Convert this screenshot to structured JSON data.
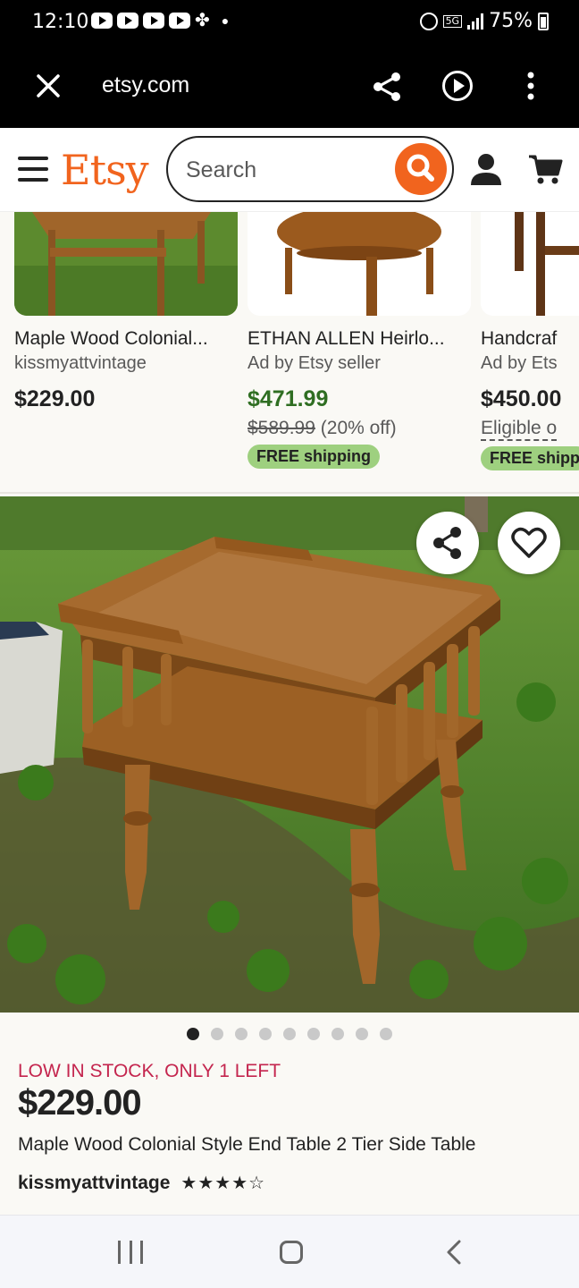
{
  "status_bar": {
    "time": "12:10",
    "network": "5G",
    "battery": "75%"
  },
  "browser": {
    "url": "etsy.com"
  },
  "header": {
    "logo": "Etsy",
    "search_placeholder": "Search",
    "accent_color": "#f1641e"
  },
  "related_listings": [
    {
      "title": "Maple Wood Colonial...",
      "seller": "kissmyattvintage",
      "price": "$229.00"
    },
    {
      "title": "ETHAN ALLEN Heirlo...",
      "seller": "Ad by Etsy seller",
      "price": "$471.99",
      "original_price": "$589.99",
      "discount": "(20% off)",
      "shipping": "FREE shipping"
    },
    {
      "title": "Handcraf",
      "seller": "Ad by Ets",
      "price": "$450.00",
      "eligible": "Eligible o",
      "shipping": "FREE shipp"
    }
  ],
  "listing": {
    "stock_notice": "LOW IN STOCK, ONLY 1 LEFT",
    "price": "$229.00",
    "title": "Maple Wood Colonial Style End Table 2 Tier Side Table",
    "shop_name": "kissmyattvintage",
    "rating_stars": "★★★★☆",
    "rating_value": 4.5,
    "image_count": 9,
    "active_image": 1
  },
  "icons": {
    "close": "close-icon",
    "share": "share-icon",
    "play": "play-circle-icon",
    "more": "more-vertical-icon",
    "menu": "hamburger-icon",
    "search": "search-icon",
    "account": "user-icon",
    "cart": "cart-icon",
    "favorite": "heart-icon"
  }
}
